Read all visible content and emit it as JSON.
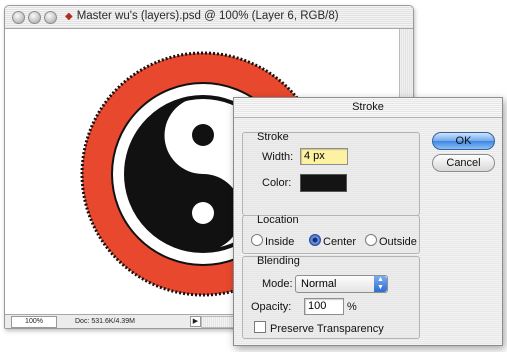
{
  "document_window": {
    "title": "Master wu's (layers).psd @ 100% (Layer 6, RGB/8)",
    "zoom": "100%",
    "doc_size": "Doc: 531.6K/4.39M",
    "status_arrow": "▶"
  },
  "artwork": {
    "ring_color": "#e8482d",
    "outline_color": "#111111",
    "symbol": "yin-yang"
  },
  "stroke_dialog": {
    "title": "Stroke",
    "stroke_group": {
      "label": "Stroke",
      "width_label": "Width:",
      "width_value": "4 px",
      "color_label": "Color:",
      "color_value": "#141414"
    },
    "location_group": {
      "label": "Location",
      "options": [
        "Inside",
        "Center",
        "Outside"
      ],
      "selected": "Center"
    },
    "blending_group": {
      "label": "Blending",
      "mode_label": "Mode:",
      "mode_value": "Normal",
      "opacity_label": "Opacity:",
      "opacity_value": "100",
      "opacity_unit": "%",
      "preserve_label": "Preserve Transparency",
      "preserve_checked": false
    },
    "ok_label": "OK",
    "cancel_label": "Cancel"
  }
}
